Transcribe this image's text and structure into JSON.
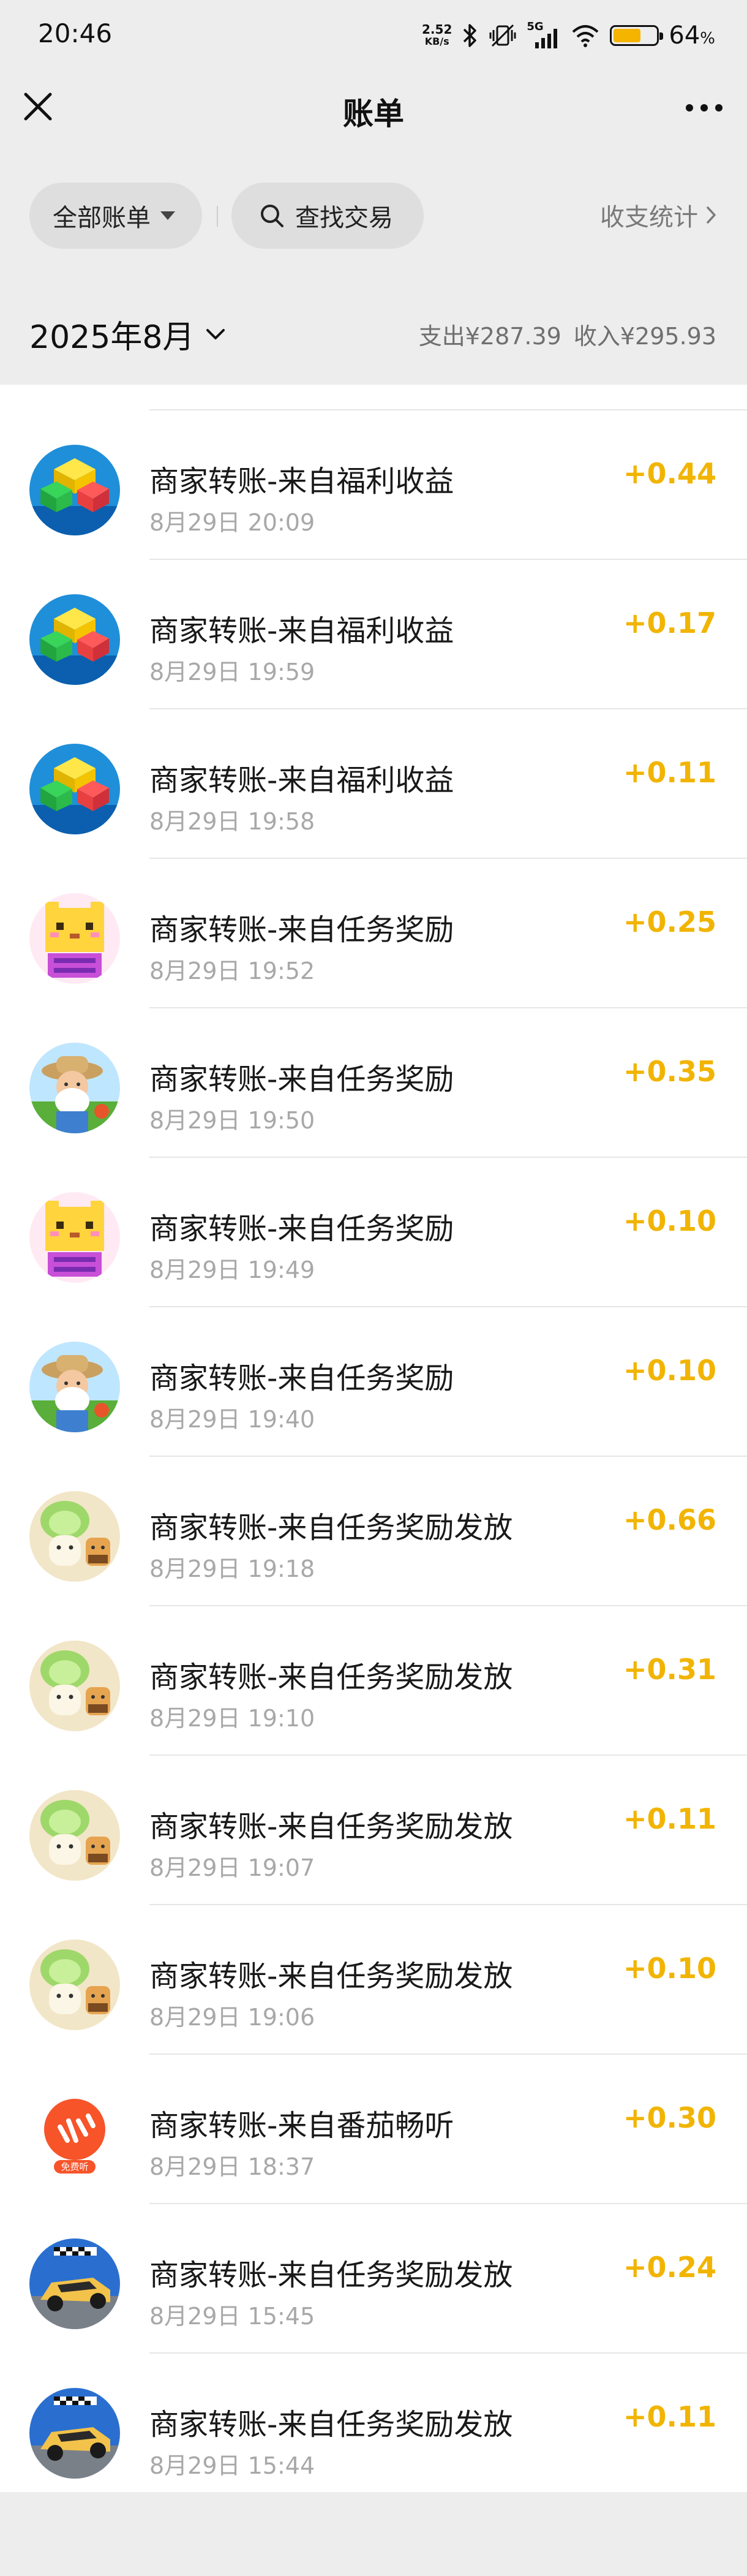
{
  "status_bar": {
    "time": "20:46",
    "net_speed_value": "2.52",
    "net_speed_unit": "KB/s",
    "network_label": "5G",
    "battery_value": "64",
    "battery_unit": "%",
    "battery_level": 0.64,
    "battery_color": "#f5b400"
  },
  "nav": {
    "title": "账单",
    "close_icon": "close-icon",
    "more_icon": "more-icon"
  },
  "filters": {
    "all_bills_label": "全部账单",
    "search_label": "查找交易",
    "stats_label": "收支统计"
  },
  "month": {
    "label": "2025年8月",
    "expense": "支出¥287.39",
    "income": "收入¥295.93"
  },
  "colors": {
    "amount": "#f1b400",
    "background": "#ededed"
  },
  "transactions": [
    {
      "title": "商家转账-来自福利收益",
      "time": "8月29日 20:09",
      "amount": "+0.44",
      "icon": "block-puzzle-icon"
    },
    {
      "title": "商家转账-来自福利收益",
      "time": "8月29日 19:59",
      "amount": "+0.17",
      "icon": "block-puzzle-icon"
    },
    {
      "title": "商家转账-来自福利收益",
      "time": "8月29日 19:58",
      "amount": "+0.11",
      "icon": "block-puzzle-icon"
    },
    {
      "title": "商家转账-来自任务奖励",
      "time": "8月29日 19:52",
      "amount": "+0.25",
      "icon": "pixel-cat-icon"
    },
    {
      "title": "商家转账-来自任务奖励",
      "time": "8月29日 19:50",
      "amount": "+0.35",
      "icon": "farmer-grandpa-icon"
    },
    {
      "title": "商家转账-来自任务奖励",
      "time": "8月29日 19:49",
      "amount": "+0.10",
      "icon": "pixel-cat-icon"
    },
    {
      "title": "商家转账-来自任务奖励",
      "time": "8月29日 19:40",
      "amount": "+0.10",
      "icon": "farmer-grandpa-icon"
    },
    {
      "title": "商家转账-来自任务奖励发放",
      "time": "8月29日 19:18",
      "amount": "+0.66",
      "icon": "cabbage-cat-icon"
    },
    {
      "title": "商家转账-来自任务奖励发放",
      "time": "8月29日 19:10",
      "amount": "+0.31",
      "icon": "cabbage-cat-icon"
    },
    {
      "title": "商家转账-来自任务奖励发放",
      "time": "8月29日 19:07",
      "amount": "+0.11",
      "icon": "cabbage-cat-icon"
    },
    {
      "title": "商家转账-来自任务奖励发放",
      "time": "8月29日 19:06",
      "amount": "+0.10",
      "icon": "cabbage-cat-icon"
    },
    {
      "title": "商家转账-来自番茄畅听",
      "time": "8月29日 18:37",
      "amount": "+0.30",
      "icon": "tomato-listen-icon",
      "badge": "免费听"
    },
    {
      "title": "商家转账-来自任务奖励发放",
      "time": "8月29日 15:45",
      "amount": "+0.24",
      "icon": "racing-car-icon"
    },
    {
      "title": "商家转账-来自任务奖励发放",
      "time": "8月29日 15:44",
      "amount": "+0.11",
      "icon": "racing-car-icon"
    }
  ]
}
